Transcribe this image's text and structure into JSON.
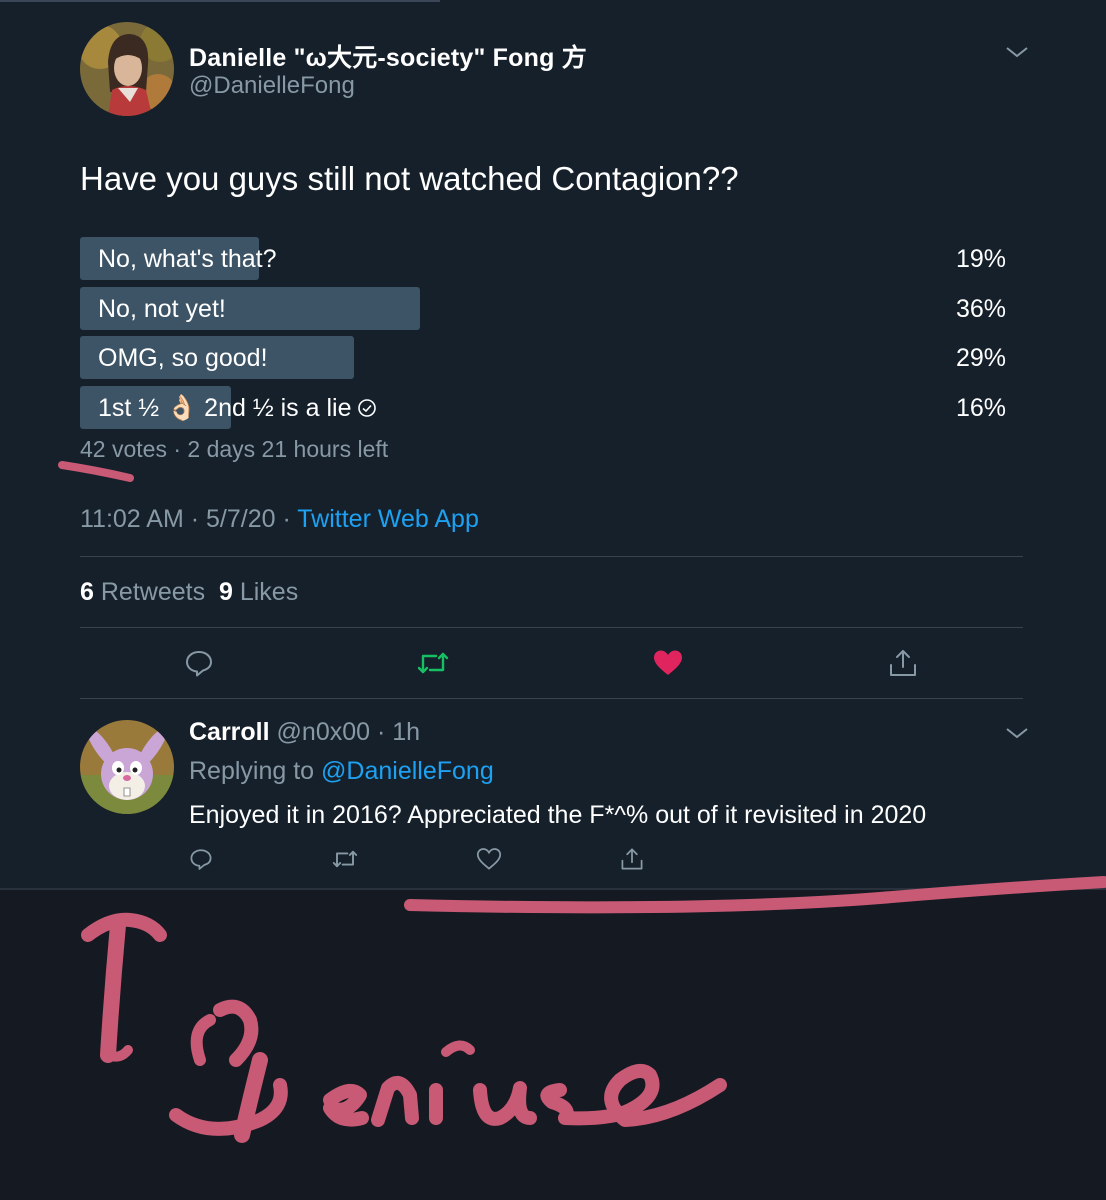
{
  "tweet": {
    "author_name": "Danielle \"ω大元-society\" Fong 方",
    "author_handle": "@DanielleFong",
    "text": "Have you guys still not watched Contagion??",
    "poll": {
      "options": [
        {
          "label": "No, what's that?",
          "percent": 19,
          "percent_label": "19%"
        },
        {
          "label": "No, not yet!",
          "percent": 36,
          "percent_label": "36%"
        },
        {
          "label": "OMG, so good!",
          "percent": 29,
          "percent_label": "29%"
        },
        {
          "label": "1st ½ 👌🏻 2nd ½ is a lie",
          "percent": 16,
          "percent_label": "16%"
        }
      ],
      "votes": "42 votes",
      "time_left": "2 days 21 hours left"
    },
    "time": "11:02 AM",
    "date": "5/7/20",
    "source": "Twitter Web App",
    "retweets": "6",
    "retweets_label": "Retweets",
    "likes": "9",
    "likes_label": "Likes"
  },
  "reply": {
    "author_name": "Carroll",
    "author_handle": "@n0x00",
    "age": "1h",
    "replying_to_label": "Replying to",
    "replying_to_handle": "@DanielleFong",
    "text": "Enjoyed it in 2016? Appreciated the F*^% out of it revisited in 2020"
  },
  "colors": {
    "background": "#15202b",
    "accent": "#1da1f2",
    "retweet_active": "#17bf63",
    "like_active": "#e0245e",
    "handwriting": "#c85a75"
  },
  "icons": [
    "reply-icon",
    "retweet-icon",
    "like-icon",
    "share-icon",
    "chevron-down-icon",
    "check-circle-icon"
  ]
}
